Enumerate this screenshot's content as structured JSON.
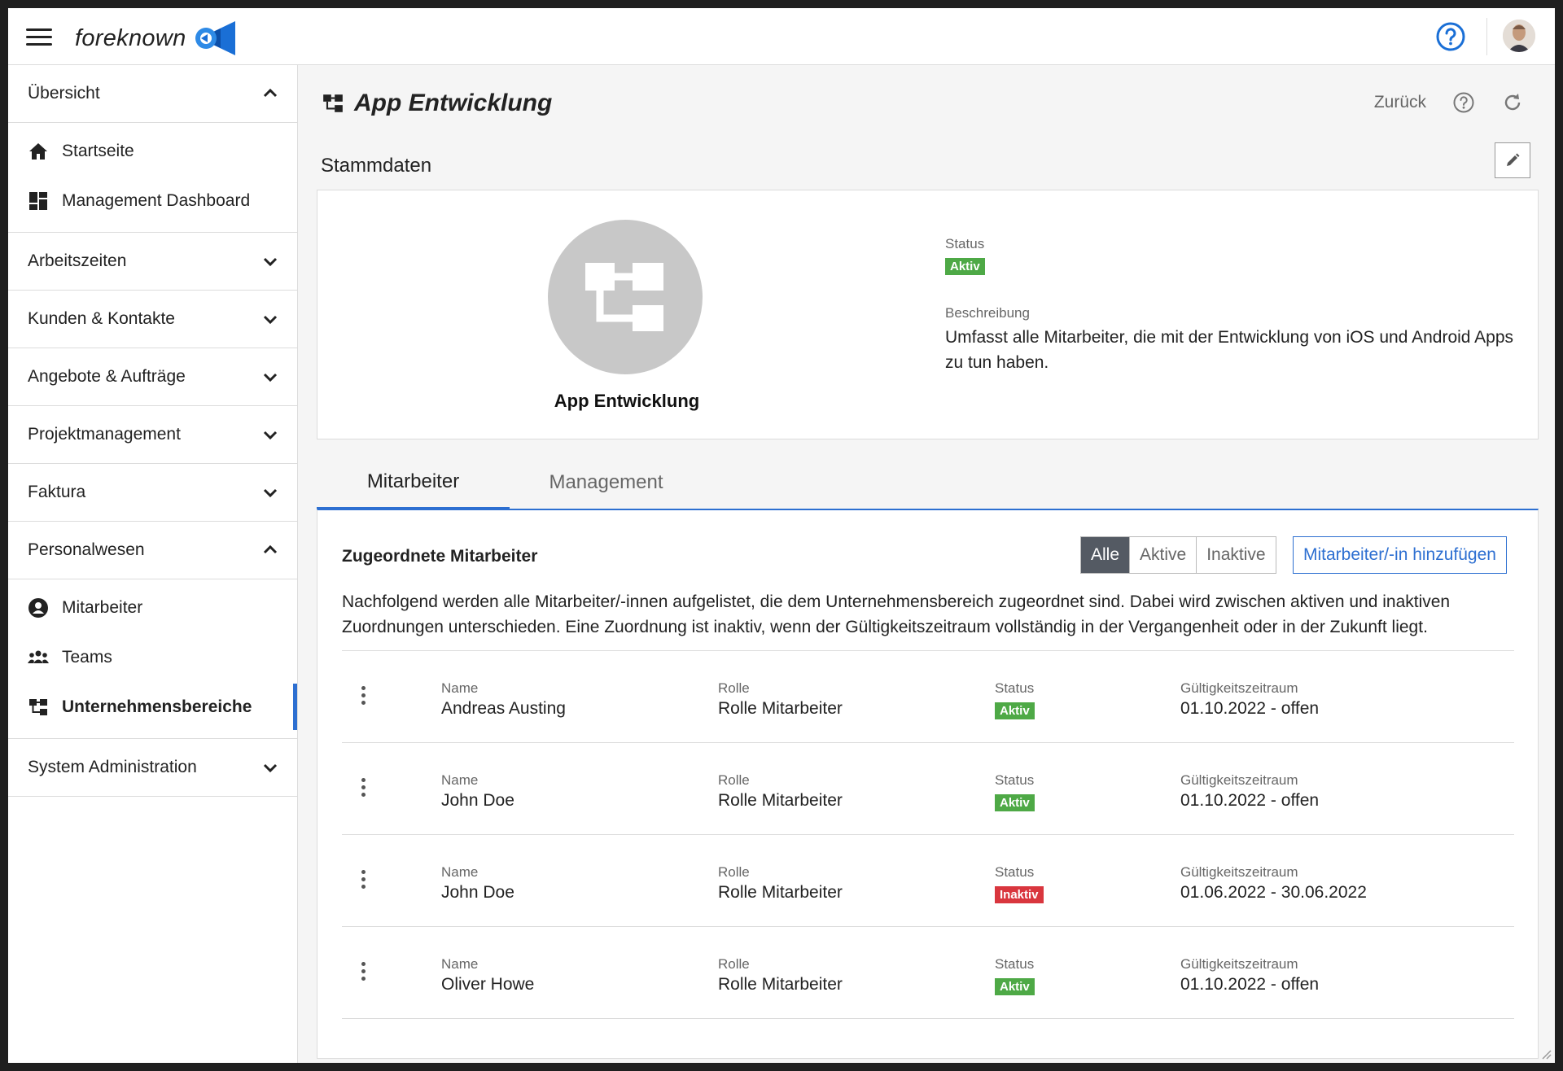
{
  "app": {
    "brand": "foreknown"
  },
  "sidebar": {
    "overview": {
      "label": "Übersicht",
      "items": [
        "Startseite",
        "Management Dashboard"
      ]
    },
    "sections": [
      "Arbeitszeiten",
      "Kunden & Kontakte",
      "Angebote & Aufträge",
      "Projektmanagement",
      "Faktura"
    ],
    "personal": {
      "label": "Personalwesen",
      "items": [
        "Mitarbeiter",
        "Teams",
        "Unternehmensbereiche"
      ]
    },
    "system": {
      "label": "System Administration"
    }
  },
  "page": {
    "title": "App Entwicklung",
    "back_label": "Zurück"
  },
  "stammdaten": {
    "section_label": "Stammdaten",
    "name": "App Entwicklung",
    "status_label": "Status",
    "status_value": "Aktiv",
    "desc_label": "Beschreibung",
    "desc_value": "Umfasst alle Mitarbeiter, die mit der Entwicklung von iOS und Android Apps zu tun haben."
  },
  "tabs": [
    "Mitarbeiter",
    "Management"
  ],
  "panel": {
    "title": "Zugeordnete Mitarbeiter",
    "filters": [
      "Alle",
      "Aktive",
      "Inaktive"
    ],
    "add_label": "Mitarbeiter/-in hinzufügen",
    "description": "Nachfolgend werden alle Mitarbeiter/-innen aufgelistet, die dem Unternehmensbereich zugeordnet sind. Dabei wird zwischen aktiven und inaktiven Zuordnungen unterschieden. Eine Zuordnung ist inaktiv, wenn der Gültigkeitszeitraum vollständig in der Vergangenheit oder in der Zukunft liegt.",
    "col_labels": {
      "name": "Name",
      "role": "Rolle",
      "status": "Status",
      "range": "Gültigkeitszeitraum"
    },
    "rows": [
      {
        "name": "Andreas Austing",
        "role": "Rolle Mitarbeiter",
        "status": "Aktiv",
        "range": "01.10.2022 - offen"
      },
      {
        "name": "John Doe",
        "role": "Rolle Mitarbeiter",
        "status": "Aktiv",
        "range": "01.10.2022 - offen"
      },
      {
        "name": "John Doe",
        "role": "Rolle Mitarbeiter",
        "status": "Inaktiv",
        "range": "01.06.2022 - 30.06.2022"
      },
      {
        "name": "Oliver Howe",
        "role": "Rolle Mitarbeiter",
        "status": "Aktiv",
        "range": "01.10.2022 - offen"
      }
    ]
  },
  "colors": {
    "accent": "#2d6fd1",
    "active": "#4ea946",
    "inactive": "#d9363e",
    "filter_active": "#545a63"
  }
}
